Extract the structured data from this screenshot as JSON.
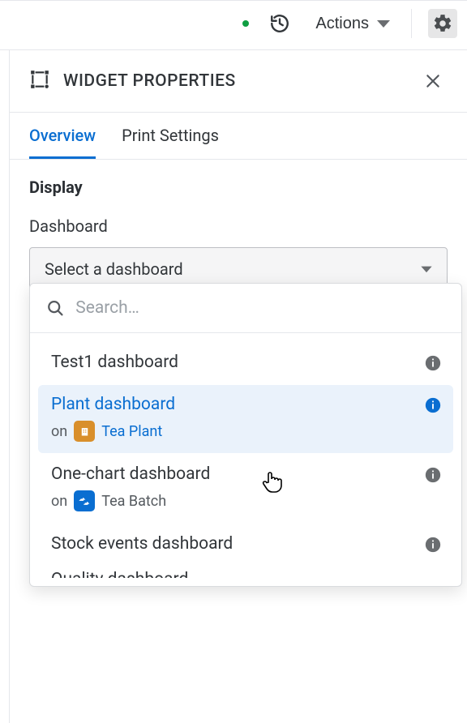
{
  "toolbar": {
    "actions_label": "Actions"
  },
  "panel": {
    "title": "WIDGET PROPERTIES"
  },
  "tabs": [
    {
      "label": "Overview",
      "active": true
    },
    {
      "label": "Print Settings",
      "active": false
    }
  ],
  "form": {
    "section": "Display",
    "dashboard_label": "Dashboard",
    "dashboard_placeholder": "Select a dashboard"
  },
  "dropdown": {
    "search_placeholder": "Search…",
    "options": [
      {
        "title": "Test1 dashboard"
      },
      {
        "title": "Plant dashboard",
        "on_label": "on",
        "context": "Tea Plant",
        "chip": "orange",
        "selected": true
      },
      {
        "title": "One-chart dashboard",
        "on_label": "on",
        "context": "Tea Batch",
        "chip": "blue"
      },
      {
        "title": "Stock events dashboard"
      },
      {
        "title": "Quality dashboard",
        "partial": true
      }
    ]
  }
}
